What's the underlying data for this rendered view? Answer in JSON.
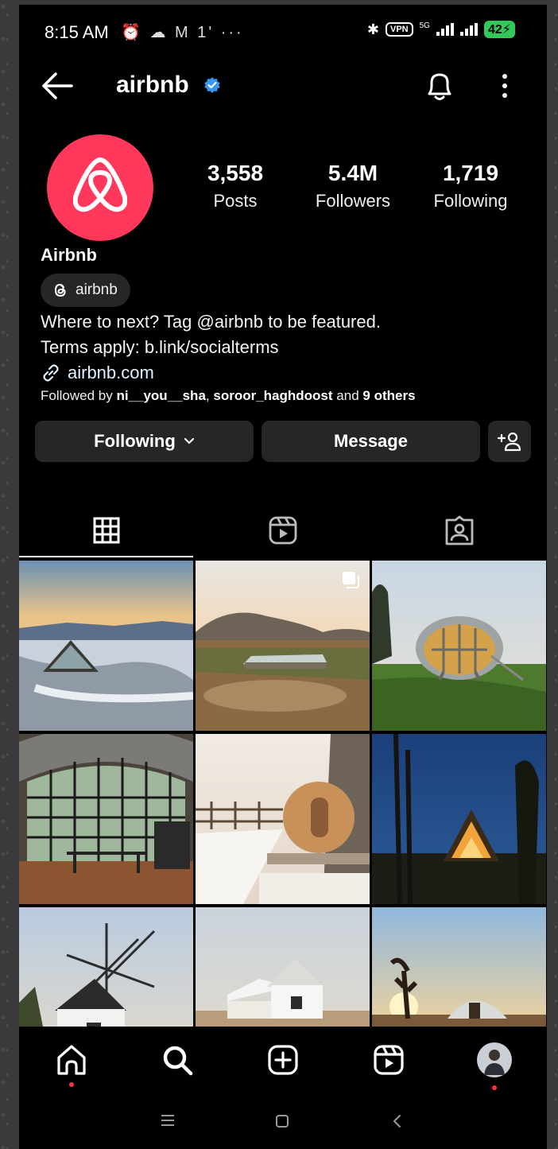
{
  "status_bar": {
    "time": "8:15 AM",
    "left_icons": "⏰ ☁ M 1' ···",
    "vpn": "VPN",
    "network": "5G",
    "battery": "42"
  },
  "header": {
    "username": "airbnb"
  },
  "profile": {
    "display_name": "Airbnb",
    "threads_handle": "airbnb",
    "stats": [
      {
        "value": "3,558",
        "label": "Posts"
      },
      {
        "value": "5.4M",
        "label": "Followers"
      },
      {
        "value": "1,719",
        "label": "Following"
      }
    ],
    "bio_line1": "Where to next? Tag @airbnb to be featured.",
    "bio_line2": "Terms apply: b.link/socialterms",
    "website": "airbnb.com",
    "followed_by_prefix": "Followed by",
    "followed_by_user1": "ni__you__sha",
    "followed_by_sep": ",",
    "followed_by_user2": "soroor_haghdoost",
    "followed_by_and": "and",
    "followed_by_others": "9 others"
  },
  "actions": {
    "following_label": "Following",
    "message_label": "Message"
  },
  "colors": {
    "brand": "#ff385c",
    "verified": "#3897f0",
    "notification_dot": "#ff3040"
  },
  "tabs": [
    "grid-icon",
    "reels-icon",
    "tagged-icon"
  ],
  "posts": [
    {
      "name": "a-frame-glass-cabin-snow"
    },
    {
      "name": "glass-greenhouse-field"
    },
    {
      "name": "spherical-pod-house"
    },
    {
      "name": "arched-glass-interior"
    },
    {
      "name": "barrel-sauna-snow"
    },
    {
      "name": "a-frame-cabin-night"
    },
    {
      "name": "windmill-house"
    },
    {
      "name": "white-desert-farmhouse"
    },
    {
      "name": "dome-joshua-tree-sunset"
    }
  ]
}
